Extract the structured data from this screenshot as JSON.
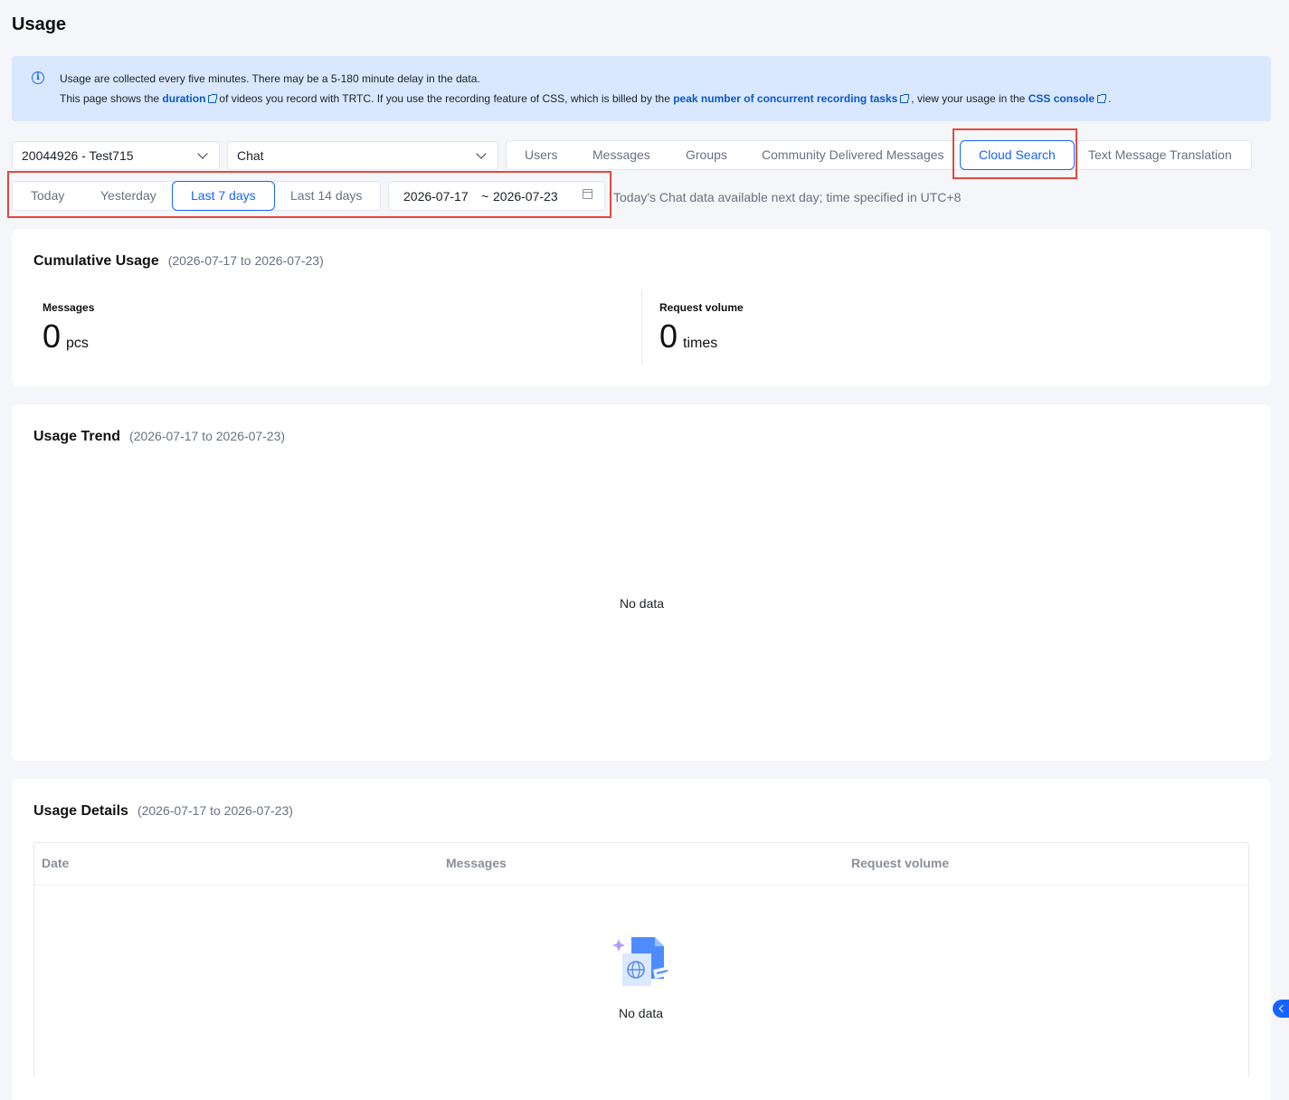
{
  "page": {
    "title": "Usage"
  },
  "notice": {
    "line1": "Usage are collected every five minutes. There may be a 5-180 minute delay in the data.",
    "line2_a": "This page shows the",
    "link_duration": "duration",
    "line2_b": "of videos you record with TRTC. If you use the recording feature of CSS, which is billed by the",
    "link_peak": "peak number of concurrent recording tasks",
    "line2_c": ", view your usage in the",
    "link_console": "CSS console",
    "line2_d": "."
  },
  "filters": {
    "app_select": "20044926 - Test715",
    "product_select": "Chat",
    "tabs": [
      {
        "label": "Users"
      },
      {
        "label": "Messages"
      },
      {
        "label": "Groups"
      },
      {
        "label": "Community Delivered Messages"
      },
      {
        "label": "Cloud Search",
        "active": true
      },
      {
        "label": "Text Message Translation"
      }
    ],
    "ranges": [
      {
        "label": "Today"
      },
      {
        "label": "Yesterday"
      },
      {
        "label": "Last 7 days",
        "active": true
      },
      {
        "label": "Last 14 days"
      }
    ],
    "date_start": "2026-07-17",
    "date_sep": "~",
    "date_end": "2026-07-23",
    "hint": "Today's Chat data available next day; time specified in UTC+8"
  },
  "cumulative": {
    "title": "Cumulative Usage",
    "range": "(2026-07-17 to 2026-07-23)",
    "messages_label": "Messages",
    "messages_value": "0",
    "messages_unit": "pcs",
    "requests_label": "Request volume",
    "requests_value": "0",
    "requests_unit": "times"
  },
  "trend": {
    "title": "Usage Trend",
    "range": "(2026-07-17 to 2026-07-23)",
    "empty": "No data"
  },
  "details": {
    "title": "Usage Details",
    "range": "(2026-07-17 to 2026-07-23)",
    "columns": [
      "Date",
      "Messages",
      "Request volume"
    ],
    "empty": "No data"
  },
  "colors": {
    "accent": "#1664ff",
    "highlight": "#e5483d",
    "notice_bg": "#d9e8ff"
  }
}
